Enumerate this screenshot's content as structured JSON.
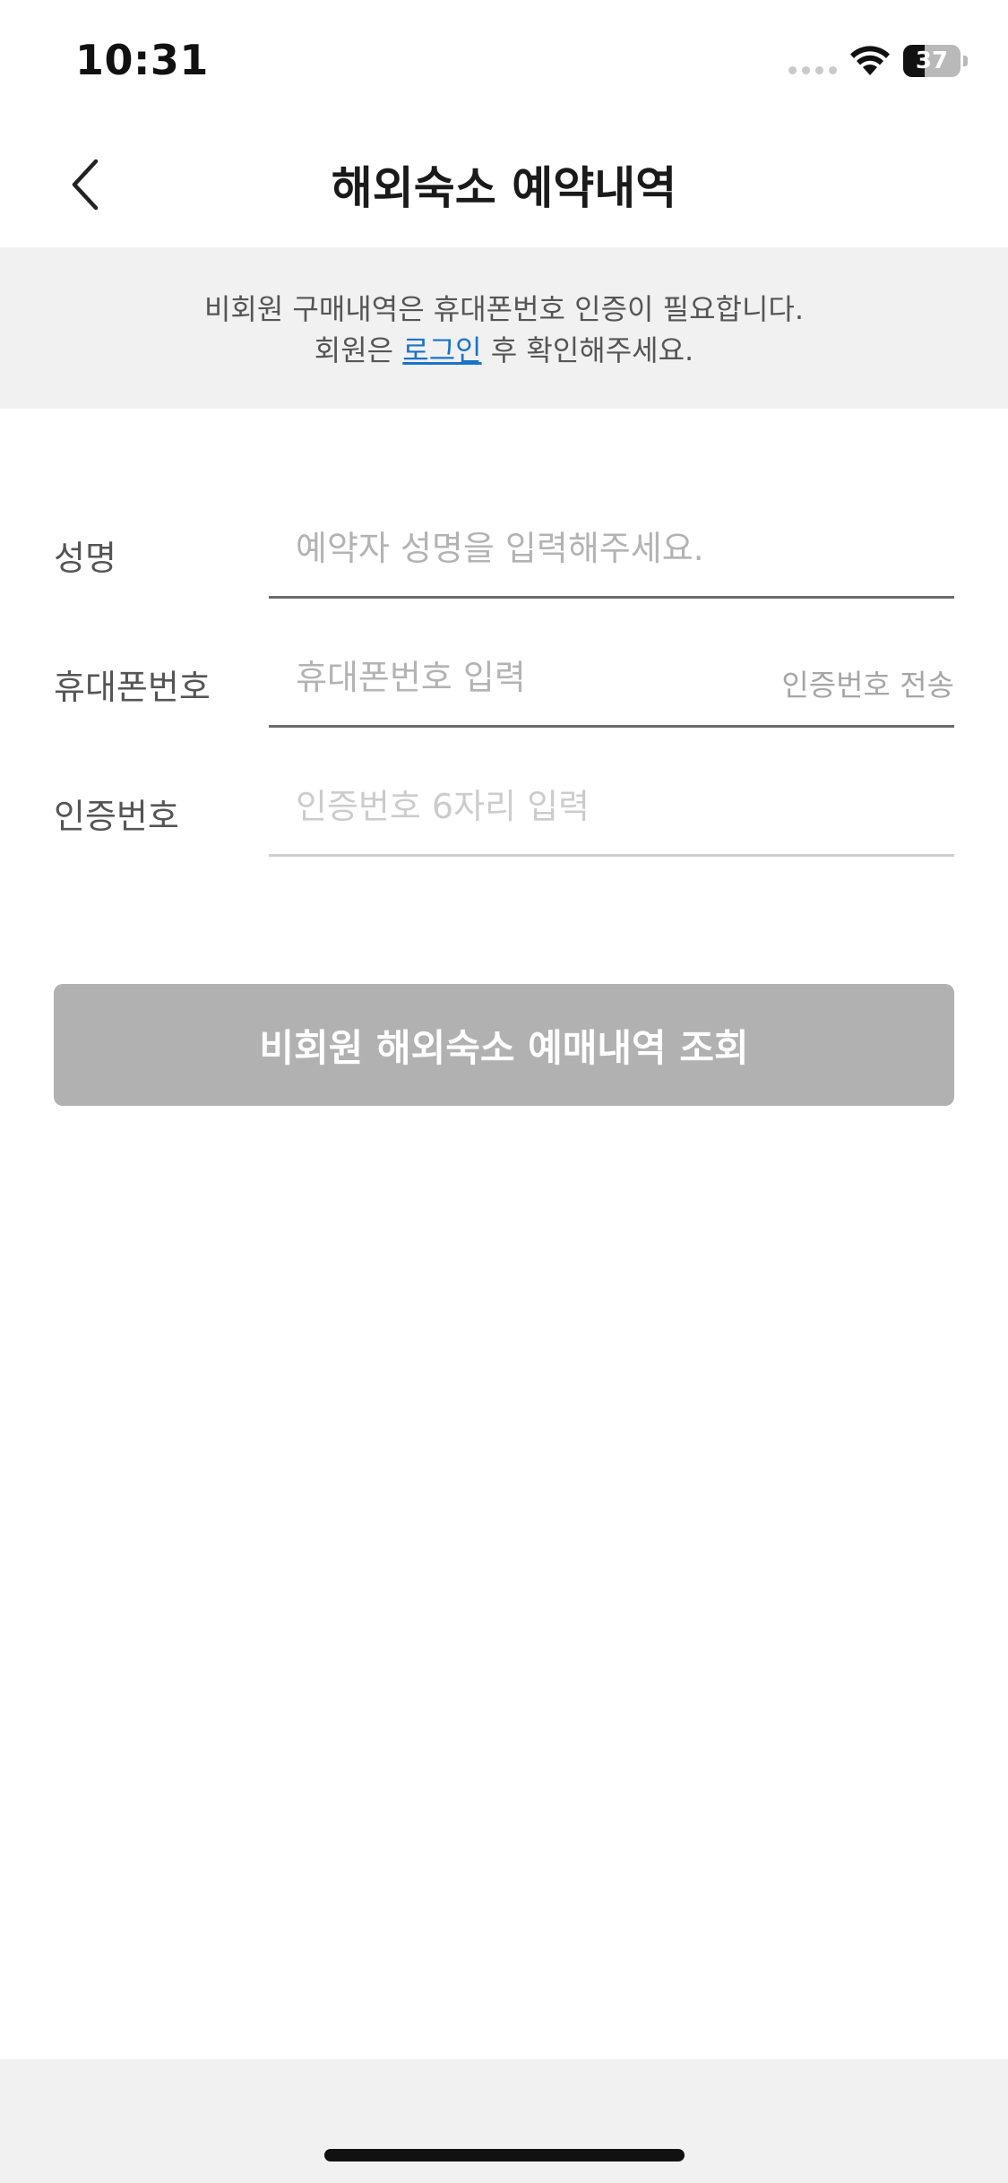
{
  "status_bar": {
    "time": "10:31",
    "battery_level": "37",
    "battery_fraction": 0.37
  },
  "header": {
    "title": "해외숙소 예약내역",
    "back_icon": "chevron-left-icon"
  },
  "notice": {
    "line1": "비회원 구매내역은 휴대폰번호 인증이 필요합니다.",
    "line2_prefix": "회원은 ",
    "login_link": "로그인",
    "line2_suffix": " 후 확인해주세요."
  },
  "form": {
    "name": {
      "label": "성명",
      "value": "",
      "placeholder": "예약자 성명을 입력해주세요."
    },
    "phone": {
      "label": "휴대폰번호",
      "value": "",
      "placeholder": "휴대폰번호 입력",
      "send_code_label": "인증번호 전송"
    },
    "code": {
      "label": "인증번호",
      "value": "",
      "placeholder": "인증번호 6자리 입력"
    }
  },
  "submit": {
    "label": "비회원 해외숙소 예매내역 조회"
  },
  "colors": {
    "accent_link": "#1a73c9",
    "button_disabled": "#b1b1b1",
    "banner_bg": "#f1f1f1"
  }
}
